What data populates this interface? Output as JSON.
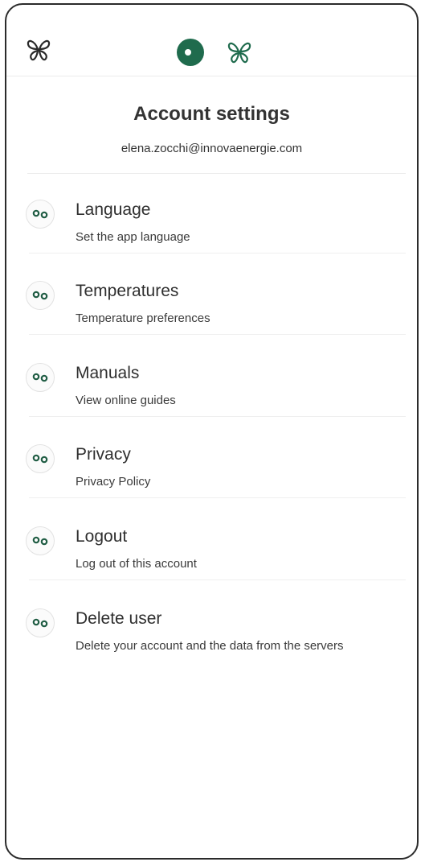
{
  "header": {
    "left_logo_icon": "butterfly-logo-icon",
    "status_icon": "status-toggle-icon",
    "center_logo_icon": "butterfly-logo-icon",
    "accent_color": "#1f6b4d"
  },
  "account": {
    "title": "Account settings",
    "email": "elena.zocchi@innovaenergie.com"
  },
  "menu": {
    "items": [
      {
        "icon": "gears-icon",
        "label": "Language",
        "description": "Set the app language"
      },
      {
        "icon": "gears-icon",
        "label": "Temperatures",
        "description": "Temperature preferences"
      },
      {
        "icon": "gears-icon",
        "label": "Manuals",
        "description": "View online guides"
      },
      {
        "icon": "gears-icon",
        "label": "Privacy",
        "description": "Privacy Policy"
      },
      {
        "icon": "gears-icon",
        "label": "Logout",
        "description": "Log out of this account"
      },
      {
        "icon": "gears-icon",
        "label": "Delete user",
        "description": "Delete your account and the data from the servers"
      }
    ]
  }
}
